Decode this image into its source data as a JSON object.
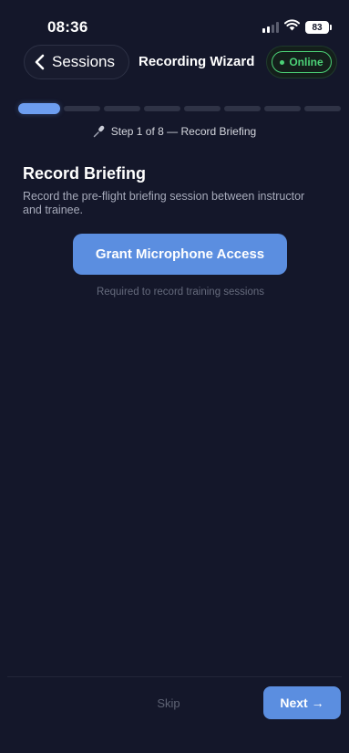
{
  "status_bar": {
    "time": "08:36",
    "battery": "83",
    "icons": [
      "signal-icon",
      "wifi-icon",
      "battery-icon"
    ]
  },
  "header": {
    "back_label": "Sessions",
    "title": "Recording Wizard",
    "status_badge": "Online"
  },
  "progress": {
    "current_step": 1,
    "total_steps": 8,
    "step_label": "Step 1 of 8 — Record Briefing"
  },
  "content": {
    "title": "Record Briefing",
    "description": "Record the pre-flight briefing session between instructor and trainee.",
    "grant_button_label": "Grant Microphone Access",
    "helper_text": "Required to record training sessions"
  },
  "footer": {
    "skip_label": "Skip",
    "next_label": "Next →"
  },
  "colors": {
    "background": "#14172a",
    "accent": "#5b8ee0",
    "online": "#4cd277"
  }
}
